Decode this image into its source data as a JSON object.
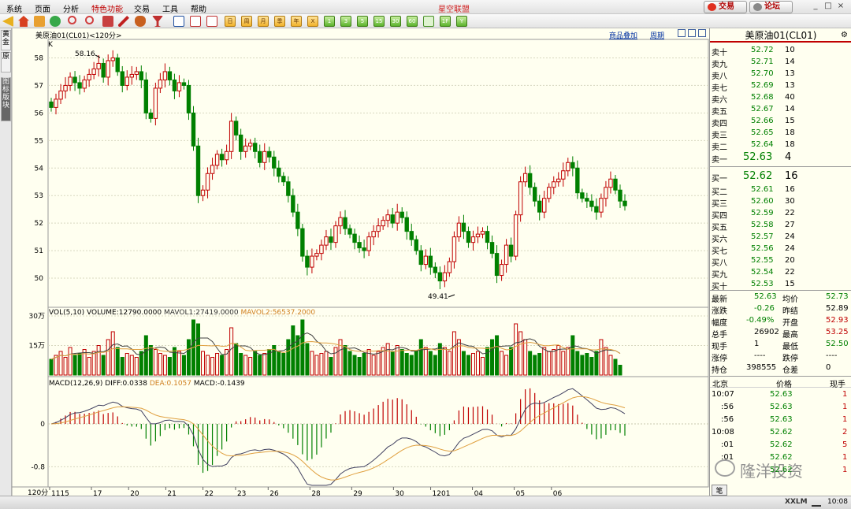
{
  "menu": {
    "items": [
      "系统",
      "页面",
      "分析",
      "特色功能",
      "交易",
      "工具",
      "帮助"
    ],
    "brand": "星空联盟",
    "trade_button": "交易",
    "forum_button": "论坛"
  },
  "toolbar": {
    "period_buttons": [
      "1",
      "3",
      "5",
      "15",
      "30",
      "60"
    ],
    "icons": [
      "back-arrow-icon",
      "home-icon",
      "folder-icon",
      "refresh-icon",
      "zoom-in-icon",
      "zoom-out-icon",
      "box-icon",
      "pen-icon",
      "paint-icon",
      "cup-icon",
      "table-icon",
      "line-chart-icon",
      "bar-chart-icon",
      "calendar-icon"
    ],
    "day_labels": [
      "日",
      "周",
      "月",
      "季",
      "年",
      "X"
    ],
    "extra_buttons": [
      "1F",
      "Y"
    ]
  },
  "left_tabs": [
    "黄金",
    "原",
    "图标版块"
  ],
  "chart": {
    "header_title": "美原油01(CL01)<120分>",
    "k_label": "K",
    "overlay_link": "商品叠加",
    "period_link": "周期",
    "high_label": "58.16",
    "low_label": "49.41",
    "vol_header": "VOL(5,10) VOLUME:12790.0000",
    "vol_ma1": "MAVOL1:27419.0000",
    "vol_ma2": "MAVOL2:56537.2000",
    "macd_header": "MACD(12,26,9)",
    "macd_diff": "DIFF:0.0338",
    "macd_dea": "DEA:0.1057",
    "macd_val": "MACD:-0.1439",
    "period_corner": "120分",
    "colors": {
      "up": "#c00000",
      "down": "#008000",
      "ma_dark": "#404040",
      "ma_orange": "#e0a040"
    }
  },
  "chart_data": {
    "type": "candlestick",
    "price_axis_ticks": [
      "58",
      "57",
      "56",
      "55",
      "54",
      "53",
      "52",
      "51",
      "50"
    ],
    "volume_axis_ticks": [
      "30万",
      "15万"
    ],
    "macd_axis_ticks": [
      "0",
      "-0.8"
    ],
    "x_ticks": [
      "1115",
      "17",
      "20",
      "21",
      "22",
      "23",
      "26",
      "28",
      "29",
      "30",
      "1201",
      "04",
      "05",
      "06"
    ],
    "price_ylim": [
      49.0,
      58.5
    ],
    "candles_close": [
      56.2,
      56.5,
      56.8,
      57.0,
      57.3,
      57.1,
      56.9,
      57.2,
      57.4,
      57.6,
      57.8,
      57.3,
      57.9,
      58.0,
      57.5,
      57.0,
      57.3,
      57.4,
      57.5,
      57.2,
      56.0,
      55.8,
      56.9,
      57.2,
      57.5,
      57.2,
      56.8,
      57.1,
      57.0,
      56.0,
      54.8,
      53.0,
      53.2,
      53.8,
      54.1,
      54.5,
      54.3,
      54.6,
      55.7,
      55.2,
      54.6,
      54.8,
      54.9,
      54.6,
      54.2,
      54.6,
      54.4,
      54.0,
      53.7,
      53.5,
      53.0,
      52.4,
      51.8,
      50.8,
      50.4,
      50.8,
      50.9,
      51.2,
      51.5,
      51.3,
      51.9,
      52.2,
      51.8,
      51.6,
      51.3,
      51.1,
      51.0,
      51.5,
      51.7,
      51.9,
      52.1,
      52.3,
      52.0,
      52.4,
      52.2,
      51.7,
      51.4,
      51.0,
      50.5,
      50.8,
      50.4,
      50.2,
      49.9,
      50.2,
      50.6,
      51.5,
      52.0,
      51.7,
      51.3,
      51.5,
      51.6,
      51.7,
      51.3,
      50.9,
      50.1,
      50.5,
      51.2,
      50.8,
      52.3,
      53.5,
      53.8,
      53.3,
      52.8,
      52.4,
      52.9,
      53.3,
      53.5,
      53.6,
      53.9,
      54.2,
      54.0,
      53.1,
      52.9,
      52.8,
      52.6,
      52.4,
      52.9,
      53.3,
      53.6,
      53.2,
      52.8,
      52.63
    ],
    "volume_series": [
      8,
      10,
      12,
      9,
      14,
      10,
      11,
      13,
      9,
      12,
      15,
      10,
      18,
      22,
      14,
      9,
      11,
      10,
      9,
      12,
      20,
      15,
      13,
      11,
      10,
      9,
      14,
      12,
      10,
      18,
      28,
      26,
      12,
      10,
      9,
      11,
      10,
      13,
      24,
      16,
      11,
      10,
      9,
      12,
      10,
      11,
      13,
      15,
      12,
      11,
      18,
      25,
      20,
      28,
      16,
      12,
      10,
      11,
      12,
      9,
      14,
      18,
      15,
      12,
      10,
      9,
      11,
      13,
      10,
      12,
      14,
      16,
      12,
      15,
      13,
      11,
      10,
      12,
      18,
      14,
      12,
      10,
      16,
      14,
      12,
      22,
      18,
      12,
      10,
      11,
      12,
      9,
      14,
      18,
      20,
      12,
      10,
      14,
      26,
      22,
      18,
      12,
      10,
      11,
      14,
      12,
      13,
      15,
      12,
      14,
      20,
      12,
      10,
      11,
      9,
      12,
      18,
      14,
      10,
      8,
      5
    ]
  },
  "quote_panel": {
    "title": "美原油01(CL01)",
    "asks": [
      {
        "label": "卖十",
        "price": "52.72",
        "qty": "10"
      },
      {
        "label": "卖九",
        "price": "52.71",
        "qty": "14"
      },
      {
        "label": "卖八",
        "price": "52.70",
        "qty": "13"
      },
      {
        "label": "卖七",
        "price": "52.69",
        "qty": "13"
      },
      {
        "label": "卖六",
        "price": "52.68",
        "qty": "40"
      },
      {
        "label": "卖五",
        "price": "52.67",
        "qty": "14"
      },
      {
        "label": "卖四",
        "price": "52.66",
        "qty": "15"
      },
      {
        "label": "卖三",
        "price": "52.65",
        "qty": "18"
      },
      {
        "label": "卖二",
        "price": "52.64",
        "qty": "18"
      },
      {
        "label": "卖一",
        "price": "52.63",
        "qty": "4"
      }
    ],
    "bids": [
      {
        "label": "买一",
        "price": "52.62",
        "qty": "16"
      },
      {
        "label": "买二",
        "price": "52.61",
        "qty": "16"
      },
      {
        "label": "买三",
        "price": "52.60",
        "qty": "30"
      },
      {
        "label": "买四",
        "price": "52.59",
        "qty": "22"
      },
      {
        "label": "买五",
        "price": "52.58",
        "qty": "27"
      },
      {
        "label": "买六",
        "price": "52.57",
        "qty": "24"
      },
      {
        "label": "买七",
        "price": "52.56",
        "qty": "24"
      },
      {
        "label": "买八",
        "price": "52.55",
        "qty": "20"
      },
      {
        "label": "买九",
        "price": "52.54",
        "qty": "22"
      },
      {
        "label": "买十",
        "price": "52.53",
        "qty": "15"
      }
    ],
    "stats": [
      {
        "l1": "最新",
        "v1": "52.63",
        "c1": "green",
        "l2": "均价",
        "v2": "52.73",
        "c2": "green"
      },
      {
        "l1": "涨跌",
        "v1": "-0.26",
        "c1": "green",
        "l2": "昨结",
        "v2": "52.89",
        "c2": "black"
      },
      {
        "l1": "幅度",
        "v1": "-0.49%",
        "c1": "green",
        "l2": "开盘",
        "v2": "52.93",
        "c2": "red"
      },
      {
        "l1": "总手",
        "v1": "26902",
        "c1": "black",
        "l2": "最高",
        "v2": "53.25",
        "c2": "red"
      },
      {
        "l1": "现手",
        "v1": "1",
        "c1": "black",
        "l2": "最低",
        "v2": "52.50",
        "c2": "green"
      },
      {
        "l1": "涨停",
        "v1": "----",
        "c1": "black",
        "l2": "跌停",
        "v2": "----",
        "c2": "black"
      },
      {
        "l1": "持仓",
        "v1": "398555",
        "c1": "black",
        "l2": "仓差",
        "v2": "0",
        "c2": "black"
      }
    ],
    "ticks_header": {
      "time": "北京",
      "price": "价格",
      "qty": "现手"
    },
    "ticks": [
      {
        "time": "10:07",
        "price": "52.63",
        "qty": "1"
      },
      {
        "time": ":56",
        "price": "52.63",
        "qty": "1"
      },
      {
        "time": ":56",
        "price": "52.63",
        "qty": "1"
      },
      {
        "time": "10:08",
        "price": "52.62",
        "qty": "2"
      },
      {
        "time": ":01",
        "price": "52.62",
        "qty": "5"
      },
      {
        "time": ":01",
        "price": "52.62",
        "qty": "1"
      },
      {
        "time": "",
        "price": "52.62",
        "qty": "1"
      }
    ],
    "watermark": "隆洋投资",
    "bottom_tab": "笔"
  },
  "status": {
    "logo": "XXLM",
    "time": "10:08"
  }
}
